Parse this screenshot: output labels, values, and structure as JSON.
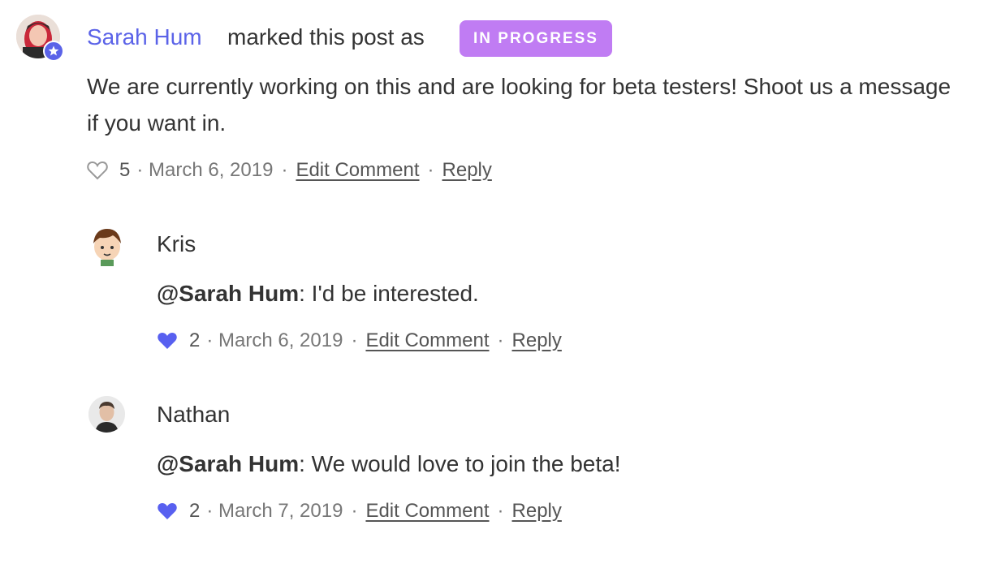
{
  "status_comment": {
    "author": "Sarah Hum",
    "action_text": "marked this post as",
    "status_badge": "IN PROGRESS",
    "body": "We are currently working on this and are looking for beta testers! Shoot us a message if you want in.",
    "likes": "5",
    "date": "· March 6, 2019",
    "edit_label": "Edit Comment",
    "reply_label": "Reply",
    "liked": false
  },
  "replies": [
    {
      "author": "Kris",
      "mention": "@Sarah Hum",
      "text": ": I'd be interested.",
      "likes": "2",
      "date": "· March 6, 2019",
      "edit_label": "Edit Comment",
      "reply_label": "Reply",
      "liked": true
    },
    {
      "author": "Nathan",
      "mention": "@Sarah Hum",
      "text": ": We would love to join the beta!",
      "likes": "2",
      "date": "· March 7, 2019",
      "edit_label": "Edit Comment",
      "reply_label": "Reply",
      "liked": true
    }
  ],
  "colors": {
    "accent": "#5b63e8",
    "badge": "#c07cf3",
    "heart_filled": "#5860f0"
  }
}
